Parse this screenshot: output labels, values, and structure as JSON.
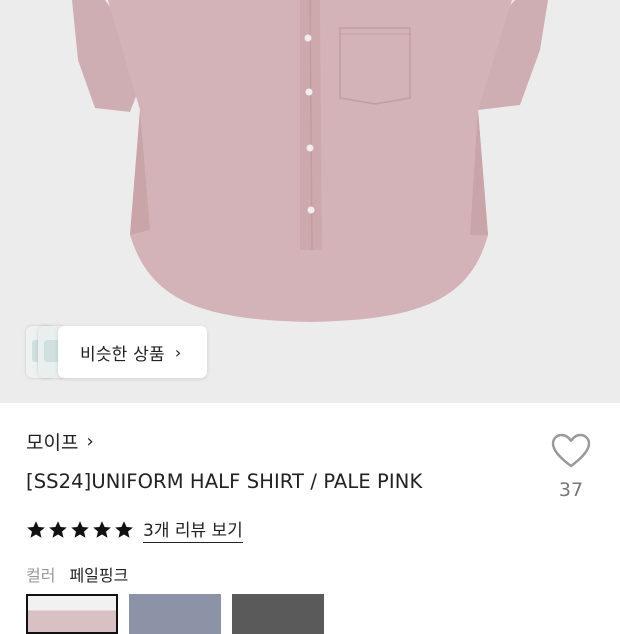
{
  "hero": {
    "similar_products_label": "비슷한 상품",
    "similar_chevron": "›"
  },
  "product": {
    "brand": "모이프",
    "brand_chevron": "›",
    "title": "[SS24]UNIFORM HALF SHIRT / PALE PINK",
    "rating_stars": 5,
    "review_link": "3개 리뷰 보기",
    "like_count": "37"
  },
  "color": {
    "label": "컬러",
    "value": "페일핑크",
    "swatches": [
      {
        "color": "#d9c0c3",
        "selected": true
      },
      {
        "color": "#8d93a6",
        "selected": false
      },
      {
        "color": "#5a5a5a",
        "selected": false
      }
    ]
  },
  "colors": {
    "shirt": "#d4b3b8",
    "hero_bg": "#ececec",
    "star": "#111111",
    "heart_stroke": "#999999"
  },
  "icons": {
    "heart": "heart-icon",
    "star": "star-icon",
    "chevron": "chevron-right-icon"
  }
}
